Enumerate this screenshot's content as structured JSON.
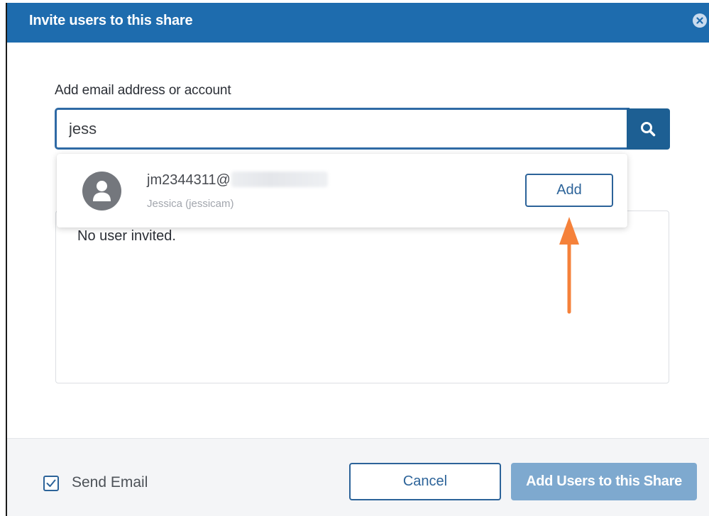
{
  "dialog": {
    "title": "Invite users to this share",
    "close_icon": "close-circle-icon"
  },
  "search": {
    "label": "Add email address or account",
    "value": "jess",
    "button_icon": "search-icon"
  },
  "suggestion": {
    "avatar_icon": "user-avatar-icon",
    "email_visible": "jm2344311@",
    "name": "Jessica (jessicam)",
    "add_label": "Add"
  },
  "invited": {
    "empty_text": "No user invited."
  },
  "footer": {
    "send_email_label": "Send Email",
    "send_email_checked": true,
    "cancel_label": "Cancel",
    "submit_label": "Add Users to this Share"
  },
  "annotation": {
    "arrow_icon": "up-arrow-icon",
    "color": "#f5813a"
  },
  "colors": {
    "header": "#1e6cae",
    "accent": "#2c6399",
    "primary_disabled": "#7ea9cf"
  }
}
